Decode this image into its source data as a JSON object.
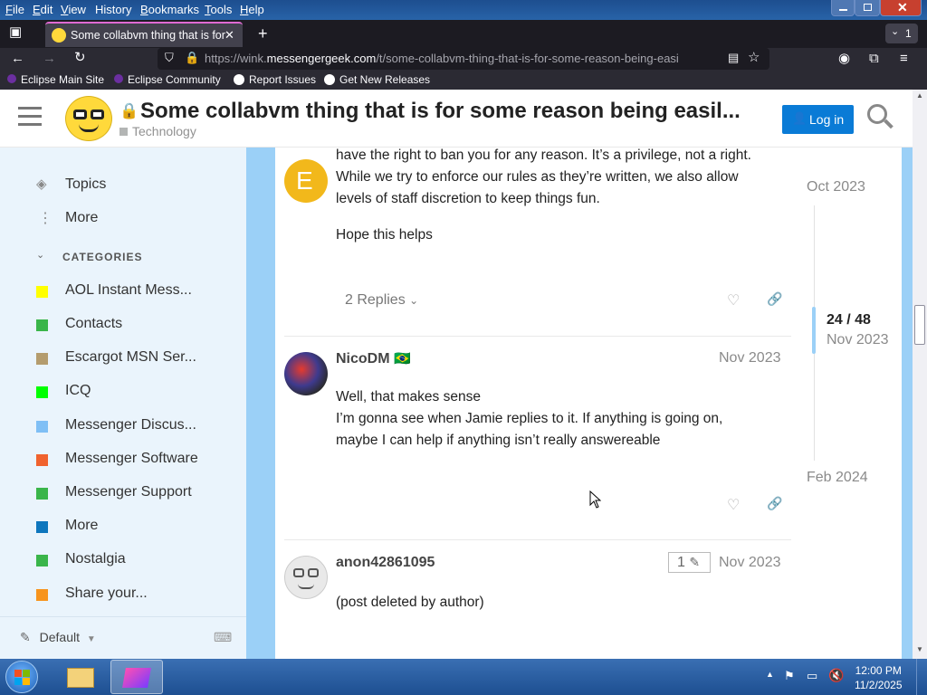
{
  "menubar": {
    "items": [
      {
        "label": "File",
        "key": "F",
        "rest": "ile"
      },
      {
        "label": "Edit",
        "key": "E",
        "rest": "dit"
      },
      {
        "label": "View",
        "key": "V",
        "rest": "iew"
      },
      {
        "label": "History",
        "key": "",
        "rest": "History"
      },
      {
        "label": "Bookmarks",
        "key": "B",
        "rest": "ookmarks"
      },
      {
        "label": "Tools",
        "key": "T",
        "rest": "ools"
      },
      {
        "label": "Help",
        "key": "H",
        "rest": "elp"
      }
    ]
  },
  "tab": {
    "title": "Some collabvm thing that is for",
    "count": "1"
  },
  "url": {
    "prefix": "https://wink.",
    "domain": "messengergeek.com",
    "path": "/t/some-collabvm-thing-that-is-for-some-reason-being-easi"
  },
  "bookmarks": [
    "Eclipse Main Site",
    "Eclipse Community",
    "Report Issues",
    "Get New Releases"
  ],
  "header": {
    "title": "Some collabvm thing that is for some reason being easil...",
    "category": "Technology",
    "login": "Log in"
  },
  "sidebar": {
    "topics": "Topics",
    "more": "More",
    "categories_heading": "CATEGORIES",
    "categories": [
      {
        "label": "AOL Instant Mess...",
        "color": "#ffff00"
      },
      {
        "label": "Contacts",
        "color": "#3ab54a"
      },
      {
        "label": "Escargot MSN Ser...",
        "color": "#b49c6e"
      },
      {
        "label": "ICQ",
        "color": "#00ff00"
      },
      {
        "label": "Messenger Discus...",
        "color": "#7fbff5"
      },
      {
        "label": "Messenger Software",
        "color": "#f0622e"
      },
      {
        "label": "Messenger Support",
        "color": "#3ab54a"
      },
      {
        "label": "More",
        "color": "#0e76bd"
      },
      {
        "label": "Nostalgia",
        "color": "#3ab54a"
      },
      {
        "label": "Share your...",
        "color": "#f7941d"
      }
    ],
    "footer": "Default"
  },
  "posts": [
    {
      "lines_top": [
        "have the right to ban you for any reason. It’s a privilege, not a right.",
        "While we try to enforce our rules as they’re written, we also allow",
        "levels of staff discretion to keep things fun."
      ],
      "extra": "Hope this helps",
      "replies": "2 Replies"
    },
    {
      "user": "NicoDM",
      "flag": "🇧🇷",
      "date": "Nov 2023",
      "lines": [
        "Well, that makes sense",
        "I’m gonna see when Jamie replies to it. If anything is going on,",
        "maybe I can help if anything isn’t really answereable"
      ]
    },
    {
      "user": "anon42861095",
      "edits": "1",
      "date": "Nov 2023",
      "text": "(post deleted by author)"
    }
  ],
  "timeline": {
    "start": "Oct 2023",
    "position": "24 / 48",
    "current": "Nov 2023",
    "end": "Feb 2024"
  },
  "clock": {
    "time": "12:00 PM",
    "date": "11/2/2025"
  },
  "colors": {
    "accent": "#0a7bd6",
    "sidebar_bg": "#eaf4fc",
    "gutter": "#9bd0f7"
  }
}
